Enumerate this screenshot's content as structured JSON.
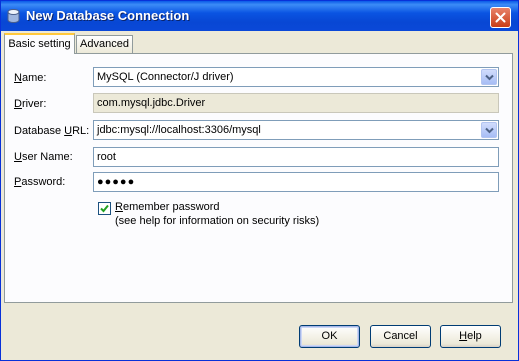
{
  "window": {
    "title": "New Database Connection"
  },
  "tabs": [
    {
      "label": "Basic setting",
      "active": true
    },
    {
      "label": "Advanced",
      "active": false
    }
  ],
  "form": {
    "name": {
      "label_mn": "N",
      "label_rest": "ame:",
      "value": "MySQL (Connector/J driver)"
    },
    "driver": {
      "label_mn": "D",
      "label_rest": "river:",
      "value": "com.mysql.jdbc.Driver"
    },
    "database_url": {
      "label_pre": "Database ",
      "label_mn": "U",
      "label_rest": "RL:",
      "value": "jdbc:mysql://localhost:3306/mysql"
    },
    "user_name": {
      "label_mn": "U",
      "label_rest": "ser Name:",
      "value": "root"
    },
    "password": {
      "label_mn": "P",
      "label_rest": "assword:",
      "value": "●●●●●"
    },
    "remember": {
      "checked": true,
      "label_mn": "R",
      "label_rest": "emember password",
      "note": "(see help for information on security risks)"
    }
  },
  "buttons": {
    "ok": "OK",
    "cancel": "Cancel",
    "help_mn": "H",
    "help_rest": "elp"
  },
  "colors": {
    "titlebar": "#0a54e2",
    "dialog_bg": "#ece9d8",
    "tab_highlight": "#ffc83c"
  }
}
